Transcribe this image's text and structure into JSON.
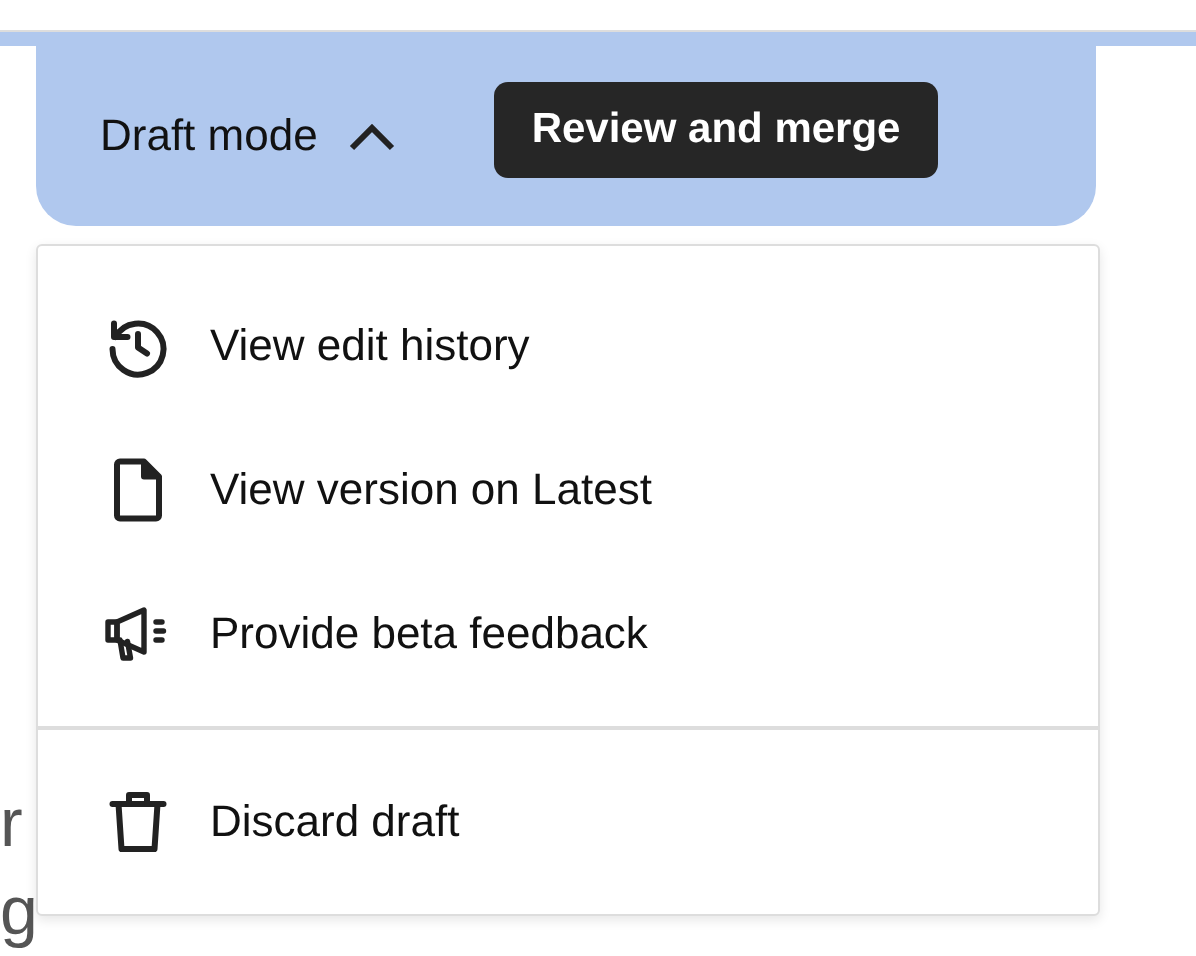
{
  "background_text": [
    "r",
    "g"
  ],
  "toolbar": {
    "mode_label": "Draft mode",
    "expanded": true,
    "primary_button": "Review and merge"
  },
  "menu": {
    "groups": [
      [
        {
          "kind": "history",
          "label": "View edit history"
        },
        {
          "kind": "document",
          "label": "View version on Latest"
        },
        {
          "kind": "megaphone",
          "label": "Provide beta feedback"
        }
      ],
      [
        {
          "kind": "trash",
          "label": "Discard draft"
        }
      ]
    ]
  }
}
